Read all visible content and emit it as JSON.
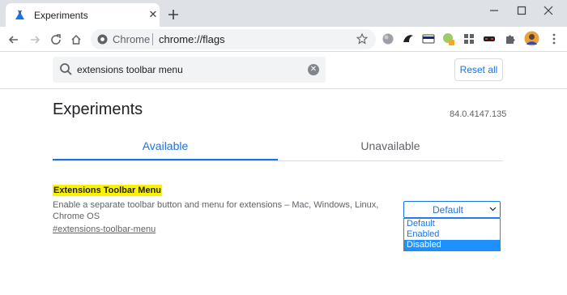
{
  "browser": {
    "tab_title": "Experiments",
    "tab_close": "✕",
    "omnibox_site": "Chrome",
    "omnibox_url": "chrome://flags"
  },
  "search": {
    "value": "extensions toolbar menu",
    "reset_label": "Reset all"
  },
  "page": {
    "title": "Experiments",
    "version": "84.0.4147.135",
    "tabs": [
      {
        "label": "Available",
        "active": true
      },
      {
        "label": "Unavailable",
        "active": false
      }
    ]
  },
  "flag": {
    "name": "Extensions Toolbar Menu",
    "description": "Enable a separate toolbar button and menu for extensions – Mac, Windows, Linux, Chrome OS",
    "link": "#extensions-toolbar-menu",
    "selected": "Default",
    "options": [
      "Default",
      "Enabled",
      "Disabled"
    ],
    "highlighted_option": "Disabled"
  },
  "colors": {
    "accent": "#1a73e8",
    "highlight": "#fbf200",
    "option_selected": "#1e90ff"
  }
}
